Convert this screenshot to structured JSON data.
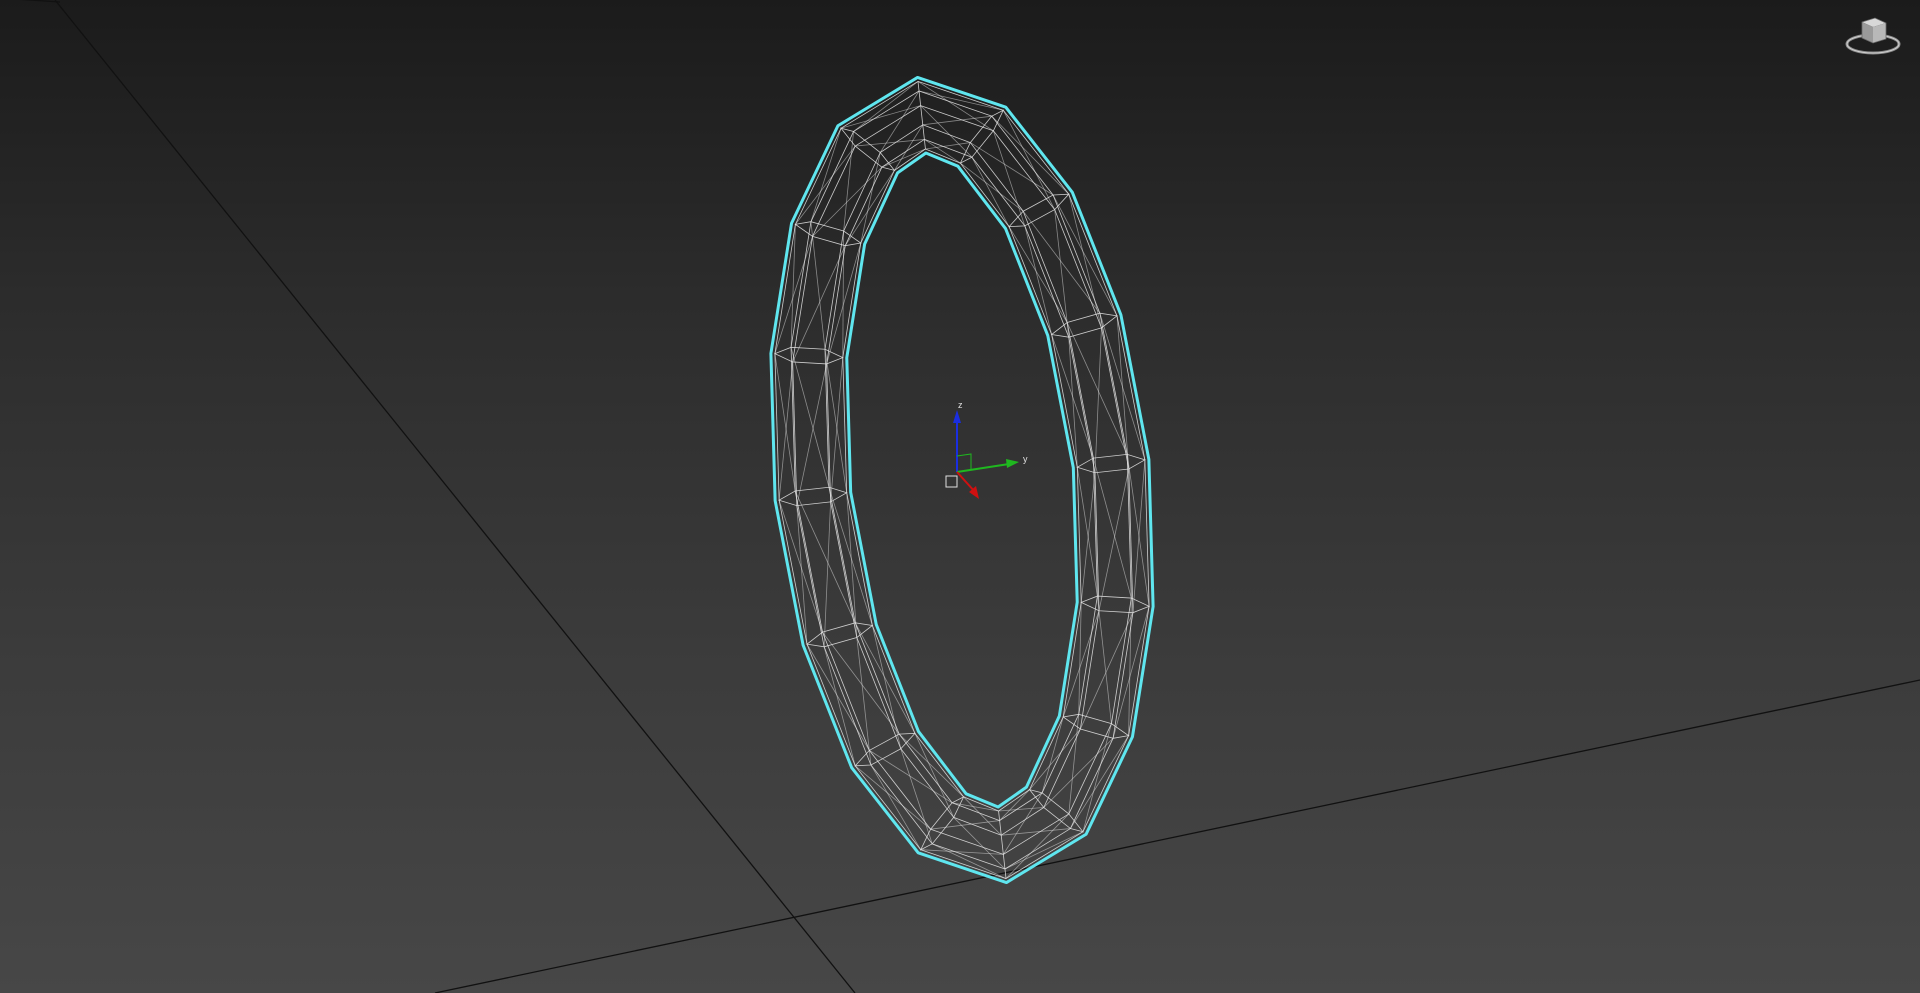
{
  "viewport": {
    "type": "3D perspective viewport",
    "render_mode": "wireframe",
    "background": "#2e2e2e",
    "grid_line_color": "#111111",
    "selection_color": "#5fe6ef",
    "wire_color": "#e8e8e8"
  },
  "object": {
    "shape": "torus ring",
    "selected": true,
    "segments": 16,
    "sides": 6
  },
  "gizmo": {
    "axes": [
      "x",
      "y",
      "z"
    ],
    "colors": {
      "x": "#d01010",
      "y": "#1fb81f",
      "z": "#1a2ee0"
    },
    "labels": {
      "y": "y",
      "z": "z"
    }
  },
  "viewcube": {
    "icon": "viewcube-icon"
  }
}
